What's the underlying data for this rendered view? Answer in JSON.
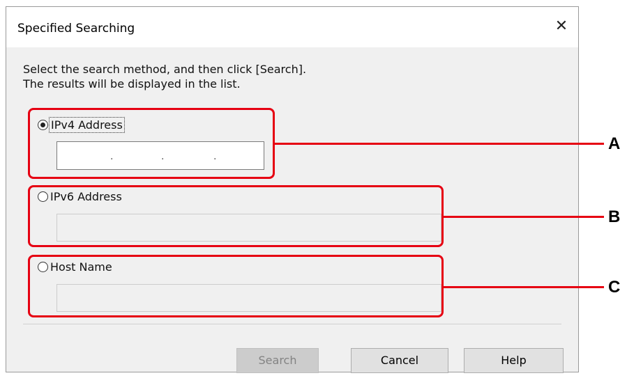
{
  "dialog": {
    "title": "Specified Searching",
    "close_glyph": "✕",
    "instructions": [
      "Select the search method, and then click [Search].",
      "The results will be displayed in the list."
    ]
  },
  "options": {
    "ipv4": {
      "label": "IPv4 Address",
      "selected": true,
      "dot": "."
    },
    "ipv6": {
      "label": "IPv6 Address",
      "selected": false,
      "value": ""
    },
    "host": {
      "label": "Host Name",
      "selected": false,
      "value": ""
    }
  },
  "buttons": {
    "search": "Search",
    "cancel": "Cancel",
    "help": "Help"
  },
  "callouts": {
    "a": "A",
    "b": "B",
    "c": "C"
  },
  "colors": {
    "highlight": "#e60012",
    "dialog_bg": "#f0f0f0"
  }
}
